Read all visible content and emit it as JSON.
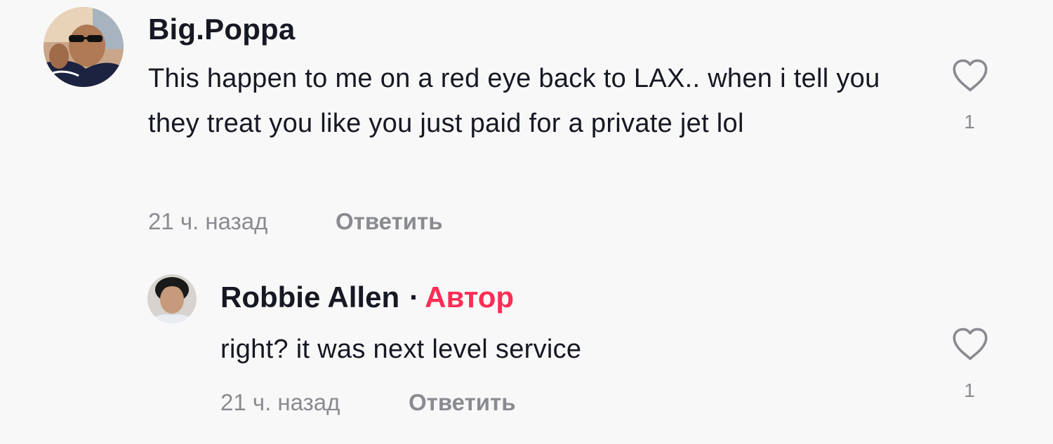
{
  "comments": [
    {
      "username": "Big.Poppa",
      "text": "This happen to me on a red eye back to LAX.. when i tell you they treat you like you just paid for a private jet lol",
      "time": "21 ч. назад",
      "reply_label": "Ответить",
      "like_count": "1"
    }
  ],
  "reply": {
    "username": "Robbie Allen",
    "separator": "·",
    "badge": "Автор",
    "text": "right? it was next level service",
    "time": "21 ч. назад",
    "reply_label": "Ответить",
    "like_count": "1"
  },
  "colors": {
    "author_badge": "#fe2c55",
    "meta_text": "#8a8b91",
    "primary_text": "#161823",
    "background": "#f8f8f8"
  },
  "icons": {
    "like": "heart-outline-icon"
  }
}
